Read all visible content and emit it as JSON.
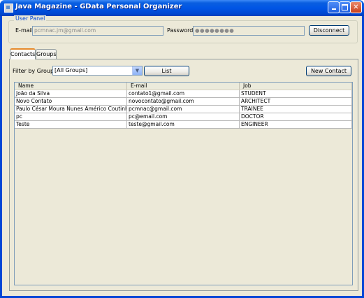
{
  "window": {
    "title": "Java Magazine - GData Personal Organizer",
    "buttons": [
      "minimize",
      "maximize",
      "close"
    ]
  },
  "user_panel": {
    "title": "User Panel",
    "email_label": "E-mail:",
    "email_value": "pcmnac.jm@gmail.com",
    "password_label": "Password:",
    "password_value": "●●●●●●●●",
    "disconnect_label": "Disconnect"
  },
  "tabs": [
    {
      "label": "Contacts",
      "selected": true
    },
    {
      "label": "Groups",
      "selected": false
    }
  ],
  "contacts": {
    "filter_label": "Filter by Group:",
    "filter_value": "[All Groups]",
    "list_label": "List",
    "new_contact_label": "New Contact",
    "columns": [
      "Name",
      "E-mail",
      "Job"
    ],
    "rows": [
      [
        "João da Silva",
        "contato1@gmail.com",
        "STUDENT"
      ],
      [
        "Novo Contato",
        "novocontato@gmail.com",
        "ARCHITECT"
      ],
      [
        "Paulo César Moura Nunes Américo Coutinho",
        "pcmnac@gmail.com",
        "TRAINEE"
      ],
      [
        "pc",
        "pc@email.com",
        "DOCTOR"
      ],
      [
        "Teste",
        "teste@gmail.com",
        "ENGINEER"
      ]
    ]
  }
}
